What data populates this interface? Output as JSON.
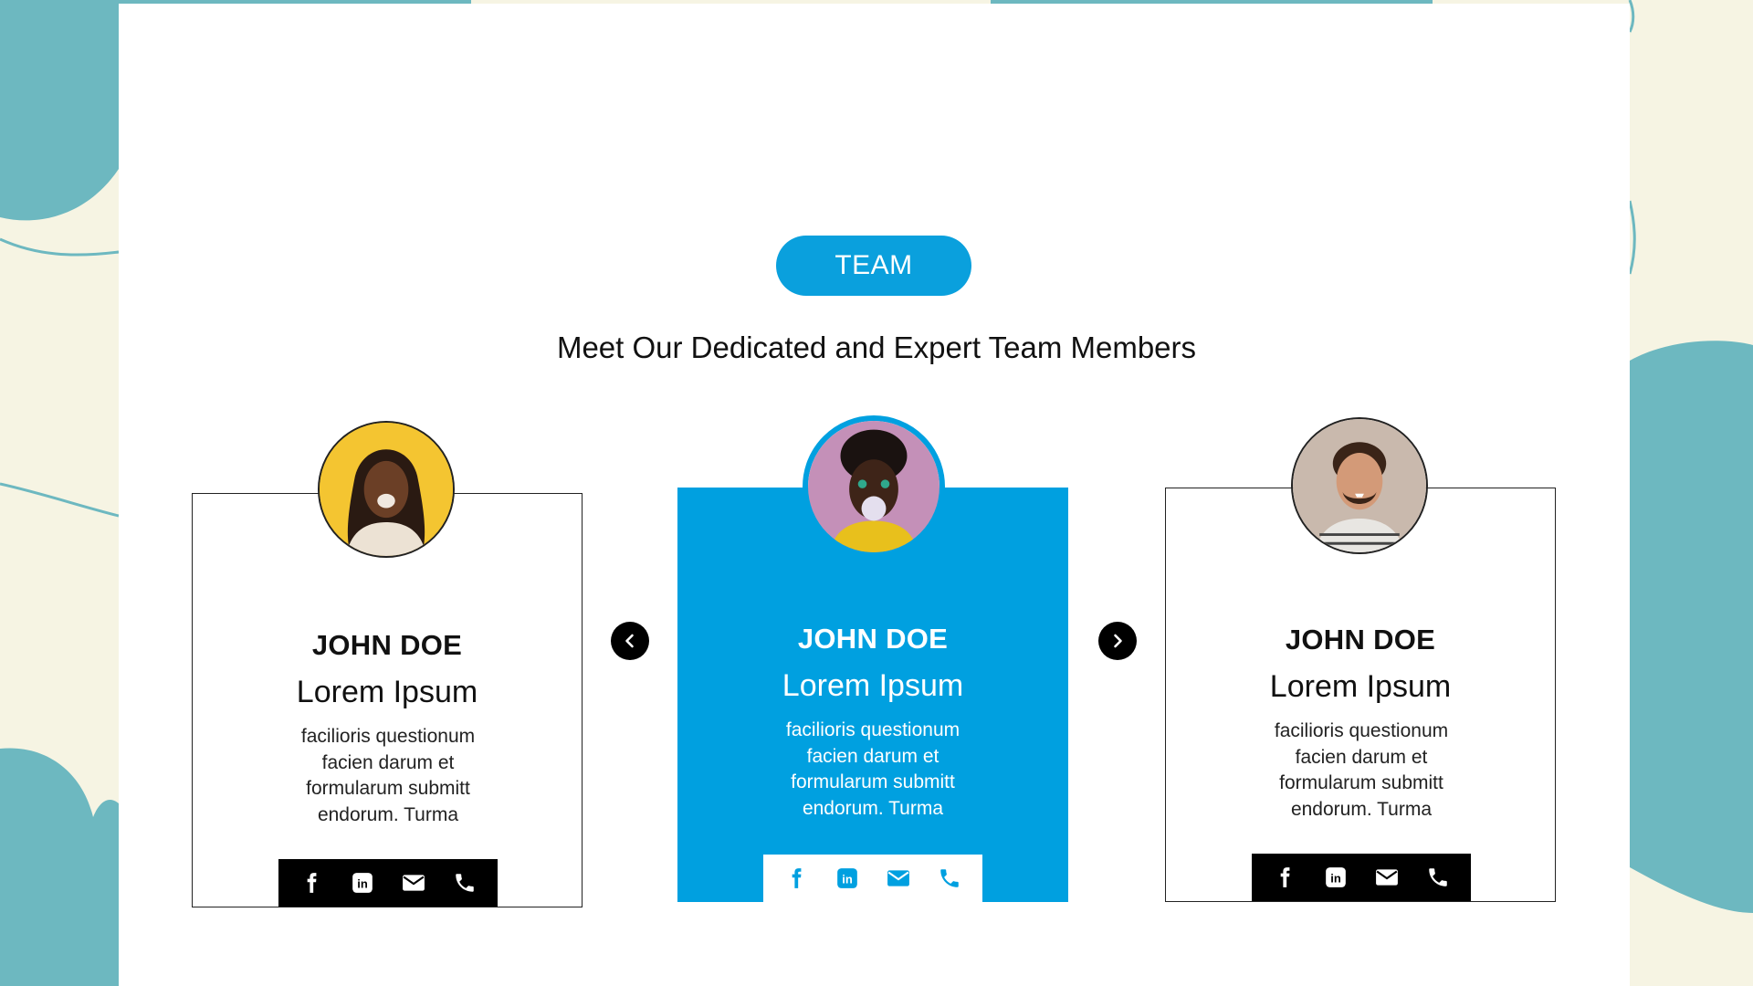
{
  "section": {
    "badge_label": "TEAM",
    "title": "Meet Our Dedicated and Expert Team Members"
  },
  "members": [
    {
      "name": "JOHN DOE",
      "role": "Lorem Ipsum",
      "desc_lines": [
        "facilioris questionum",
        "facien darum et",
        "formularum submitt",
        "endorum. Turma"
      ]
    },
    {
      "name": "JOHN DOE",
      "role": "Lorem Ipsum",
      "desc_lines": [
        "facilioris questionum",
        "facien darum et",
        "formularum submitt",
        "endorum. Turma"
      ]
    },
    {
      "name": "JOHN DOE",
      "role": "Lorem Ipsum",
      "desc_lines": [
        "facilioris questionum",
        "facien darum et",
        "formularum submitt",
        "endorum. Turma"
      ]
    }
  ],
  "social_icons": [
    "facebook-icon",
    "linkedin-icon",
    "email-icon",
    "phone-icon"
  ],
  "nav": {
    "prev_icon": "chevron-left-icon",
    "next_icon": "chevron-right-icon"
  },
  "colors": {
    "accent": "#00a0e0",
    "background": "#f6f4e3",
    "blob": "#6db8c0",
    "text": "#111111"
  }
}
